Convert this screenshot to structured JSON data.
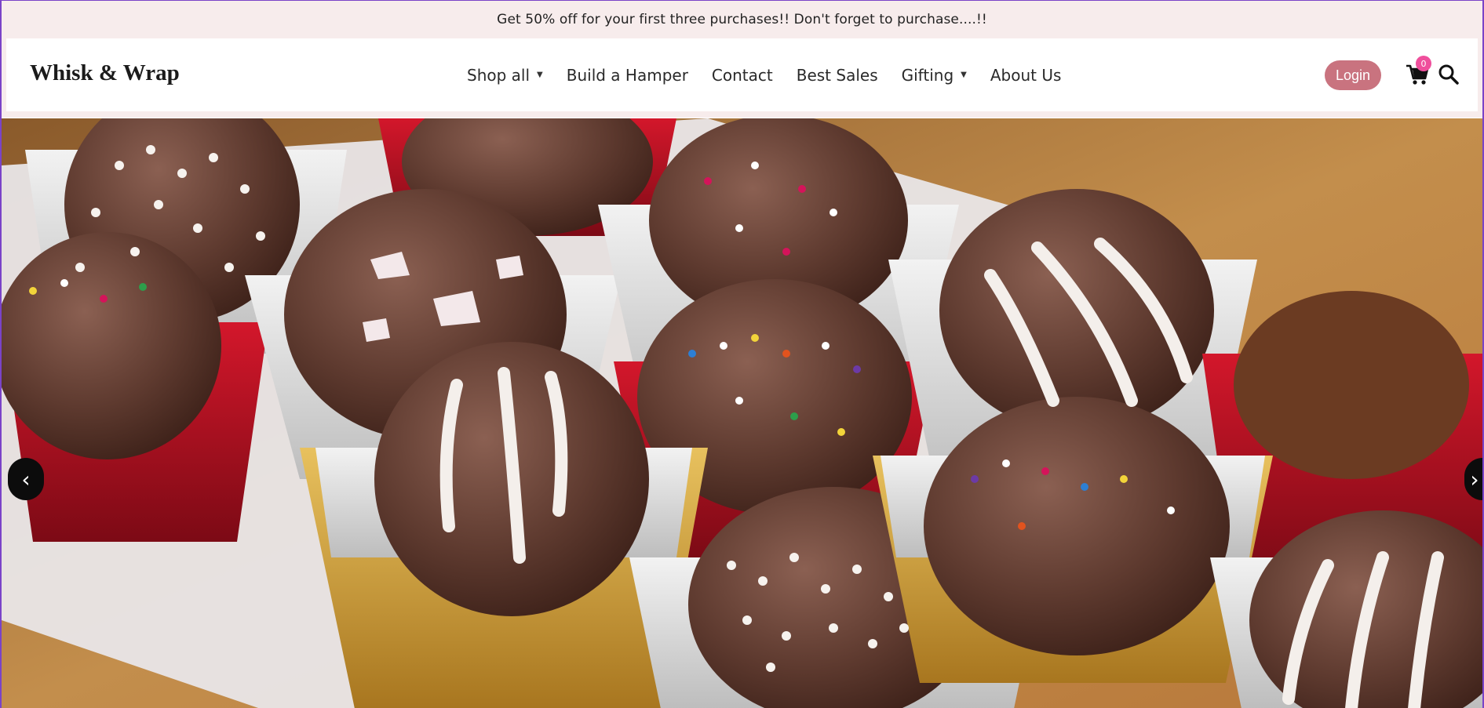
{
  "announcement": {
    "text": "Get 50% off for your first three purchases!! Don't forget to purchase....!!"
  },
  "header": {
    "logo": "Whisk & Wrap",
    "nav": [
      {
        "label": "Shop all",
        "dropdown": true
      },
      {
        "label": "Build a Hamper",
        "dropdown": false
      },
      {
        "label": "Contact",
        "dropdown": false
      },
      {
        "label": "Best Sales",
        "dropdown": false
      },
      {
        "label": "Gifting",
        "dropdown": true
      },
      {
        "label": "About Us",
        "dropdown": false
      }
    ],
    "login_label": "Login",
    "cart_count": "0",
    "cart_icon": "shopping-cart-icon",
    "search_icon": "magnifier-icon"
  },
  "hero": {
    "image": "chocolate-truffles-in-cupcake-liners",
    "prev_label": "‹",
    "next_label": "›"
  },
  "colors": {
    "announcement_bg": "#f7ecec",
    "login_bg": "#c9737f",
    "badge_bg": "#ef4f9c",
    "arrow_bg": "#0c0c0c"
  }
}
